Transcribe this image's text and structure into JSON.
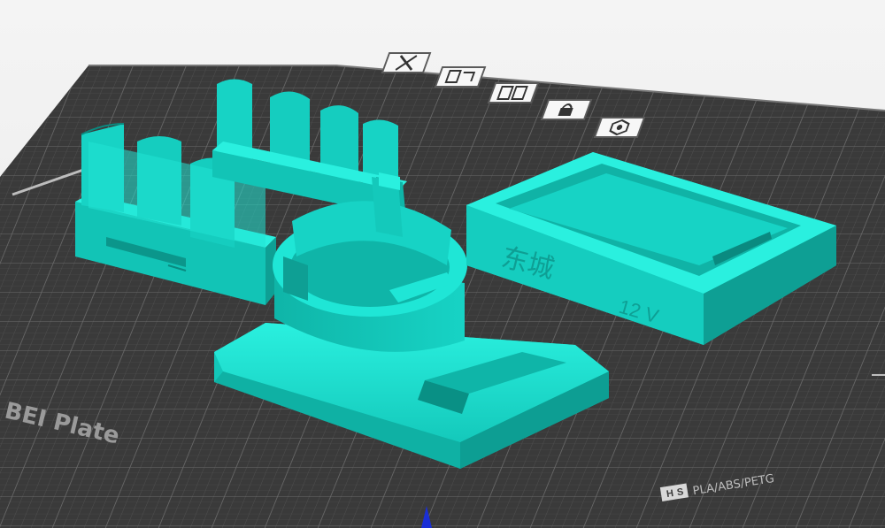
{
  "plate": {
    "label": "BEI Plate",
    "material": "PLA/ABS/PETG"
  },
  "toolbar": {
    "items": [
      {
        "name": "delete-icon",
        "glyph": "X"
      },
      {
        "name": "arrange-icon"
      },
      {
        "name": "orient-icon"
      },
      {
        "name": "lock-icon"
      },
      {
        "name": "settings-icon"
      }
    ]
  },
  "models": {
    "box_engraving": "东城",
    "box_voltage": "12 V"
  },
  "colors": {
    "model": "#19e0d0",
    "model_shade": "#10b3a6",
    "model_dark": "#0a8a80",
    "plate": "#3b3b3b",
    "grid": "#5a5a5a",
    "background": "#f0f0f0",
    "axis_z": "#1a2fd6"
  }
}
